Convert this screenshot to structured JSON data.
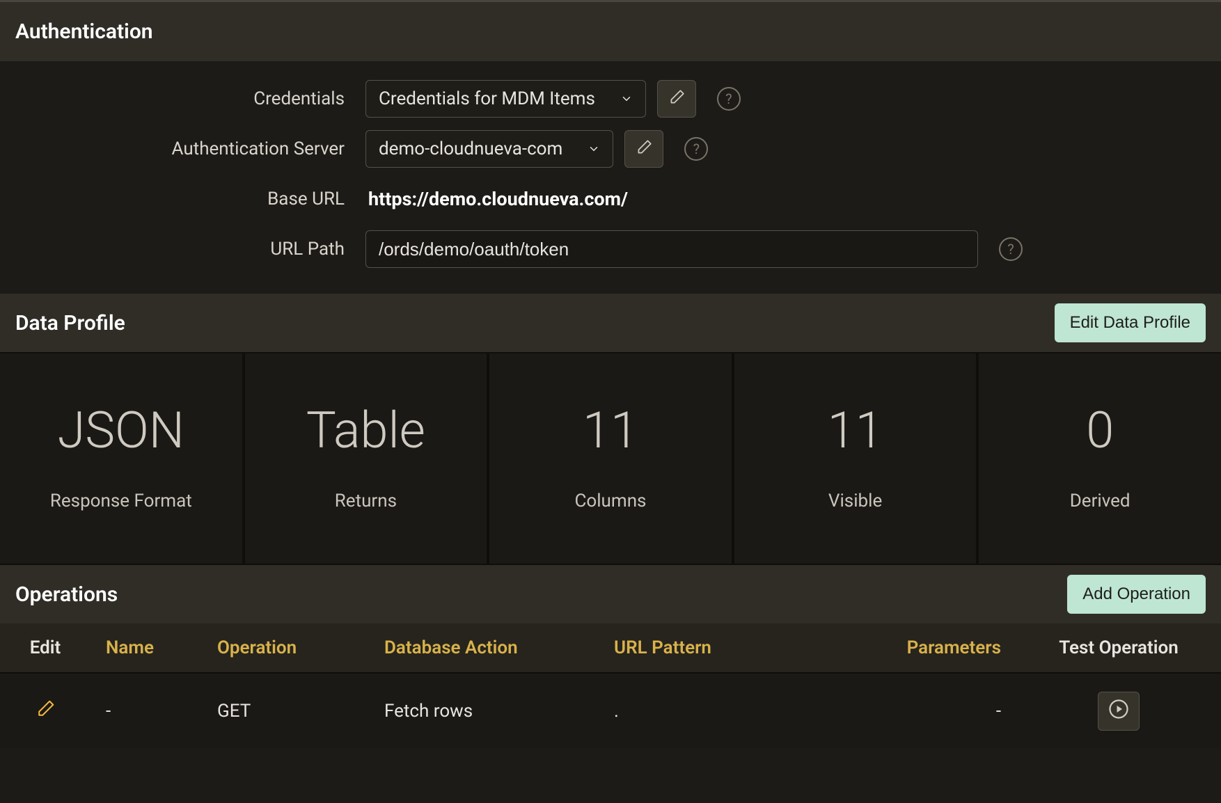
{
  "authentication": {
    "title": "Authentication",
    "fields": {
      "credentials": {
        "label": "Credentials",
        "value": "Credentials for MDM Items"
      },
      "auth_server": {
        "label": "Authentication Server",
        "value": "demo-cloudnueva-com"
      },
      "base_url": {
        "label": "Base URL",
        "value": "https://demo.cloudnueva.com/"
      },
      "url_path": {
        "label": "URL Path",
        "value": "/ords/demo/oauth/token"
      }
    }
  },
  "data_profile": {
    "title": "Data Profile",
    "edit_button": "Edit Data Profile",
    "cards": [
      {
        "value": "JSON",
        "label": "Response Format"
      },
      {
        "value": "Table",
        "label": "Returns"
      },
      {
        "value": "11",
        "label": "Columns"
      },
      {
        "value": "11",
        "label": "Visible"
      },
      {
        "value": "0",
        "label": "Derived"
      }
    ]
  },
  "operations": {
    "title": "Operations",
    "add_button": "Add Operation",
    "columns": {
      "edit": "Edit",
      "name": "Name",
      "operation": "Operation",
      "database_action": "Database Action",
      "url_pattern": "URL Pattern",
      "parameters": "Parameters",
      "test_operation": "Test Operation"
    },
    "rows": [
      {
        "name": "-",
        "operation": "GET",
        "database_action": "Fetch rows",
        "url_pattern": ".",
        "parameters": "-"
      }
    ]
  },
  "icons": {
    "pencil": "pencil-icon",
    "chevron_down": "chevron-down-icon",
    "help": "?",
    "play": "play-icon"
  }
}
